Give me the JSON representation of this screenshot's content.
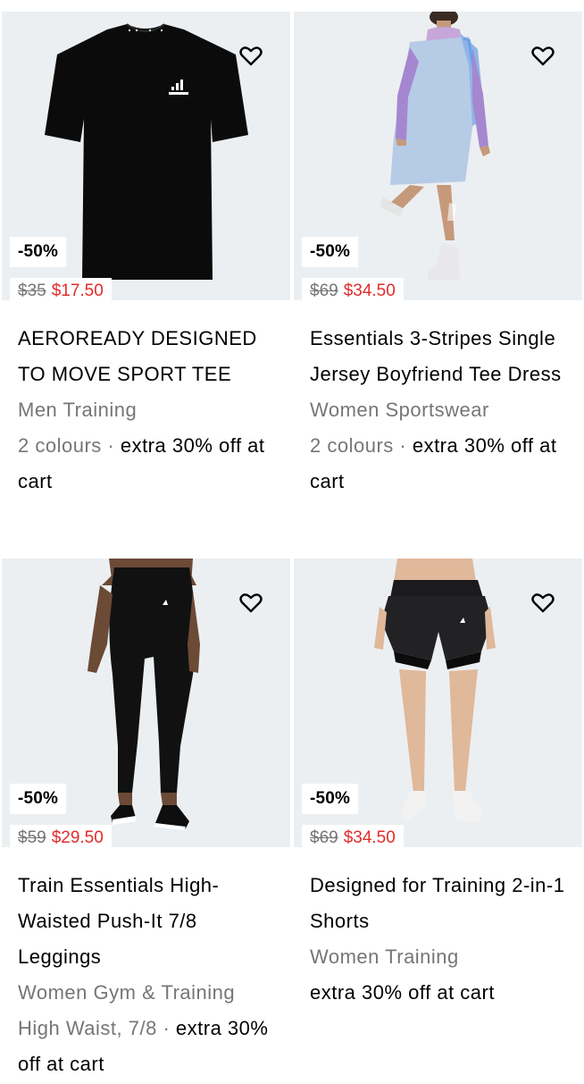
{
  "products": [
    {
      "name": "AEROREADY DESIGNED TO MOVE SPORT TEE",
      "category": "Men Training",
      "colours": "2 colours ·",
      "offer": " extra 30% off at cart",
      "discount": "-50%",
      "old_price": "$35",
      "new_price": "$17.50",
      "wishlist_icon": "heart-outline-icon"
    },
    {
      "name": "Essentials 3-Stripes Single Jersey Boyfriend Tee Dress",
      "category": "Women Sportswear",
      "colours": "2 colours ·",
      "offer": " extra 30% off at cart",
      "discount": "-50%",
      "old_price": "$69",
      "new_price": "$34.50",
      "wishlist_icon": "heart-outline-icon"
    },
    {
      "name": "Train Essentials High-Waisted Push-It 7/8 Leggings",
      "category": "Women Gym & Training",
      "colours": "High Waist, 7/8 ·",
      "offer": " extra 30% off at cart",
      "discount": "-50%",
      "old_price": "$59",
      "new_price": "$29.50",
      "wishlist_icon": "heart-outline-icon"
    },
    {
      "name": "Designed for Training 2-in-1 Shorts",
      "category": "Women Training",
      "colours": "",
      "offer": "extra 30% off at cart",
      "discount": "-50%",
      "old_price": "$69",
      "new_price": "$34.50",
      "wishlist_icon": "heart-outline-icon"
    }
  ],
  "colors": {
    "image_bg": "#eceff1",
    "sale_price": "#e32b2b",
    "muted_text": "#767677"
  }
}
